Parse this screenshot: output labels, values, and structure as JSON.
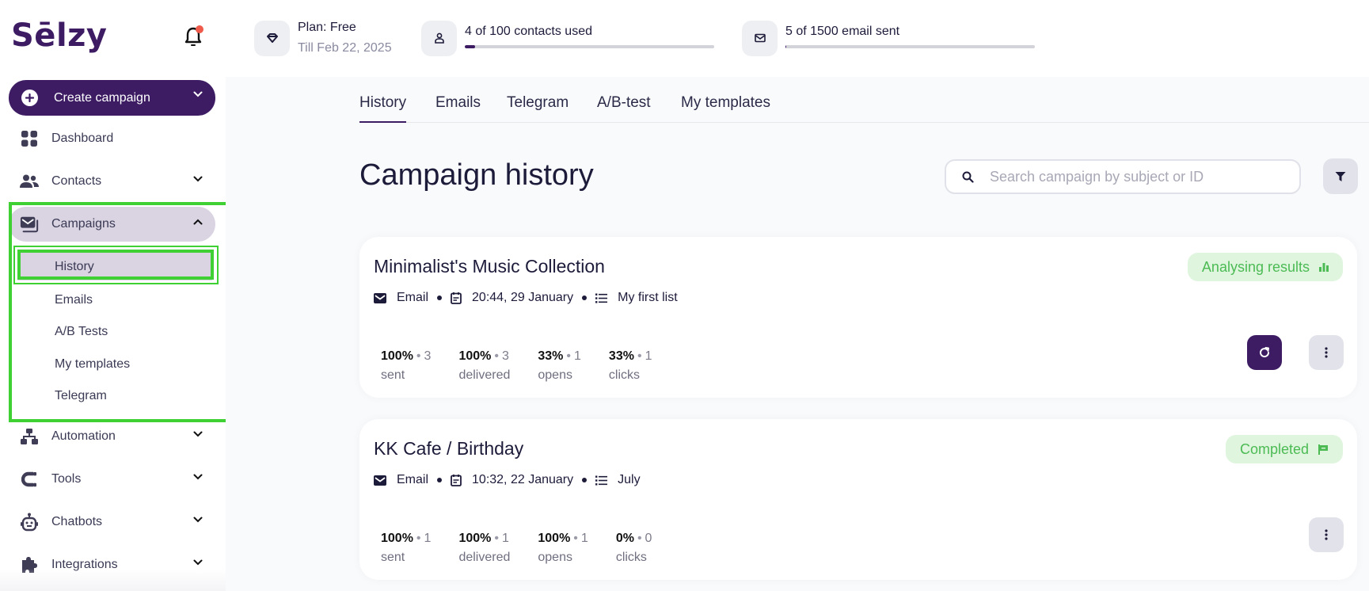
{
  "brand": {
    "logo_text": "Sēlzy",
    "accent": "#3d1c64",
    "notification_dot": "#ef5a4a"
  },
  "header": {
    "plan": {
      "icon": "diamond-icon",
      "title": "Plan: Free",
      "subtitle": "Till Feb 22, 2025"
    },
    "contacts": {
      "icon": "user-icon",
      "label": "4 of 100 contacts used",
      "used": 4,
      "total": 100,
      "progress_percent": 4
    },
    "emails": {
      "icon": "envelope-icon",
      "label": "5 of 1500 email sent",
      "used": 5,
      "total": 1500,
      "progress_percent": 0.33
    },
    "notifications": {
      "icon": "bell-icon",
      "has_unread": true
    }
  },
  "sidebar": {
    "create_button": {
      "label": "Create campaign",
      "icon": "plus-circle-icon"
    },
    "items": [
      {
        "label": "Dashboard",
        "icon": "dashboard-grid-icon",
        "expandable": false
      },
      {
        "label": "Contacts",
        "icon": "contacts-icon",
        "expandable": true
      },
      {
        "label": "Campaigns",
        "icon": "campaigns-icon",
        "expandable": true,
        "expanded": true,
        "active": true
      },
      {
        "label": "Automation",
        "icon": "automation-icon",
        "expandable": true
      },
      {
        "label": "Tools",
        "icon": "magnet-icon",
        "expandable": true
      },
      {
        "label": "Chatbots",
        "icon": "robot-icon",
        "expandable": true
      },
      {
        "label": "Integrations",
        "icon": "puzzle-icon",
        "expandable": true
      }
    ],
    "campaign_subitems": [
      {
        "label": "History",
        "active": true
      },
      {
        "label": "Emails"
      },
      {
        "label": "A/B Tests"
      },
      {
        "label": "My templates"
      },
      {
        "label": "Telegram"
      }
    ]
  },
  "main": {
    "tabs": [
      {
        "label": "History",
        "active": true
      },
      {
        "label": "Emails"
      },
      {
        "label": "Telegram"
      },
      {
        "label": "A/B-test"
      },
      {
        "label": "My templates"
      }
    ],
    "title": "Campaign history",
    "search": {
      "placeholder": "Search campaign by subject or ID",
      "value": ""
    },
    "campaigns": [
      {
        "title": "Minimalist's Music Collection",
        "type": "Email",
        "datetime": "20:44, 29 January",
        "list": "My first list",
        "status": "Analysing results",
        "status_icon": "bar-chart-icon",
        "status_color": "#4cbb54",
        "has_refresh": true,
        "stats": [
          {
            "percent": "100%",
            "count": "3",
            "label": "sent"
          },
          {
            "percent": "100%",
            "count": "3",
            "label": "delivered"
          },
          {
            "percent": "33%",
            "count": "1",
            "label": "opens"
          },
          {
            "percent": "33%",
            "count": "1",
            "label": "clicks"
          }
        ]
      },
      {
        "title": "KK Cafe / Birthday",
        "type": "Email",
        "datetime": "10:32, 22 January",
        "list": "July",
        "status": "Completed",
        "status_icon": "flag-icon",
        "status_color": "#4cbb54",
        "has_refresh": false,
        "stats": [
          {
            "percent": "100%",
            "count": "1",
            "label": "sent"
          },
          {
            "percent": "100%",
            "count": "1",
            "label": "delivered"
          },
          {
            "percent": "100%",
            "count": "1",
            "label": "opens"
          },
          {
            "percent": "0%",
            "count": "0",
            "label": "clicks"
          }
        ]
      }
    ]
  }
}
